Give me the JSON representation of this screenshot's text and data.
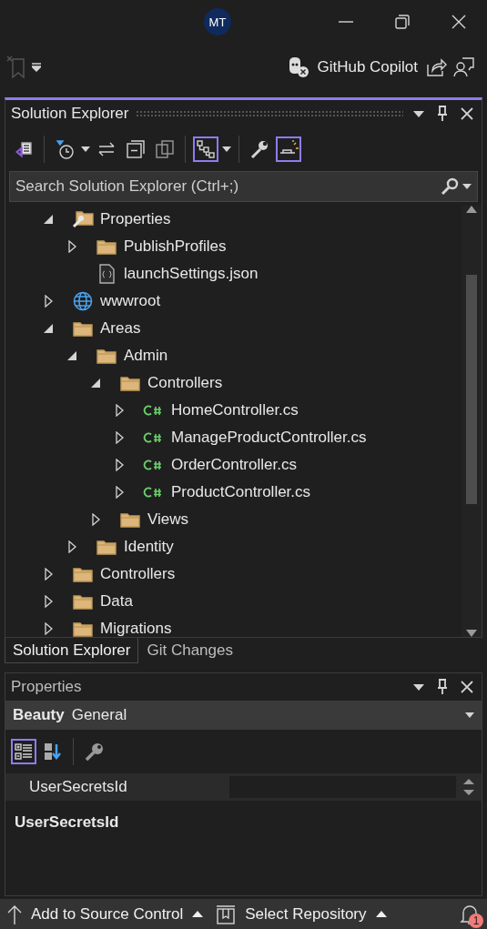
{
  "title_bar": {
    "avatar": "MT"
  },
  "top_toolbar": {
    "copilot_label": "GitHub Copilot"
  },
  "solution_explorer": {
    "title": "Solution Explorer",
    "toolbar": [
      {
        "kind": "vs-doc",
        "selected": false
      },
      {
        "kind": "sep"
      },
      {
        "kind": "history",
        "selected": false
      },
      {
        "kind": "caret"
      },
      {
        "kind": "sync",
        "selected": false
      },
      {
        "kind": "collapse",
        "selected": false
      },
      {
        "kind": "copies",
        "selected": false
      },
      {
        "kind": "sep"
      },
      {
        "kind": "tree-view",
        "selected": true
      },
      {
        "kind": "caret"
      },
      {
        "kind": "sep"
      },
      {
        "kind": "wrench",
        "selected": false
      },
      {
        "kind": "preview",
        "selected": true
      }
    ],
    "search": {
      "placeholder": "Search Solution Explorer (Ctrl+;)"
    },
    "tree": [
      {
        "label": "Properties",
        "kind": "properties-folder",
        "expanded": true,
        "children": [
          {
            "label": "PublishProfiles",
            "kind": "folder",
            "expanded": false
          },
          {
            "label": "launchSettings.json",
            "kind": "json",
            "expanded": false
          }
        ]
      },
      {
        "label": "wwwroot",
        "kind": "web-root",
        "expanded": false
      },
      {
        "label": "Areas",
        "kind": "folder",
        "expanded": true,
        "children": [
          {
            "label": "Admin",
            "kind": "folder",
            "expanded": true,
            "children": [
              {
                "label": "Controllers",
                "kind": "folder",
                "expanded": true,
                "children": [
                  {
                    "label": "HomeController.cs",
                    "kind": "csharp",
                    "expanded": false
                  },
                  {
                    "label": "ManageProductController.cs",
                    "kind": "csharp",
                    "expanded": false
                  },
                  {
                    "label": "OrderController.cs",
                    "kind": "csharp",
                    "expanded": false
                  },
                  {
                    "label": "ProductController.cs",
                    "kind": "csharp",
                    "expanded": false
                  }
                ]
              },
              {
                "label": "Views",
                "kind": "folder",
                "expanded": false
              }
            ]
          },
          {
            "label": "Identity",
            "kind": "folder",
            "expanded": false
          }
        ]
      },
      {
        "label": "Controllers",
        "kind": "folder",
        "expanded": false
      },
      {
        "label": "Data",
        "kind": "folder",
        "expanded": false
      },
      {
        "label": "Migrations",
        "kind": "folder",
        "expanded": false
      }
    ]
  },
  "bottom_tabs": [
    {
      "label": "Solution Explorer",
      "selected": true
    },
    {
      "label": "Git Changes",
      "selected": false
    }
  ],
  "properties": {
    "title": "Properties",
    "object_name": "Beauty",
    "object_type": "General",
    "toolbar": [
      {
        "kind": "categorized",
        "selected": true
      },
      {
        "kind": "alphabetical",
        "selected": false
      },
      {
        "kind": "sep"
      },
      {
        "kind": "property-pages",
        "selected": false
      }
    ],
    "rows": [
      {
        "name": "UserSecretsId"
      }
    ],
    "description_title": "UserSecretsId"
  },
  "status_bar": {
    "source_control": "Add to Source Control",
    "repository": "Select Repository",
    "notification_count": "1"
  }
}
